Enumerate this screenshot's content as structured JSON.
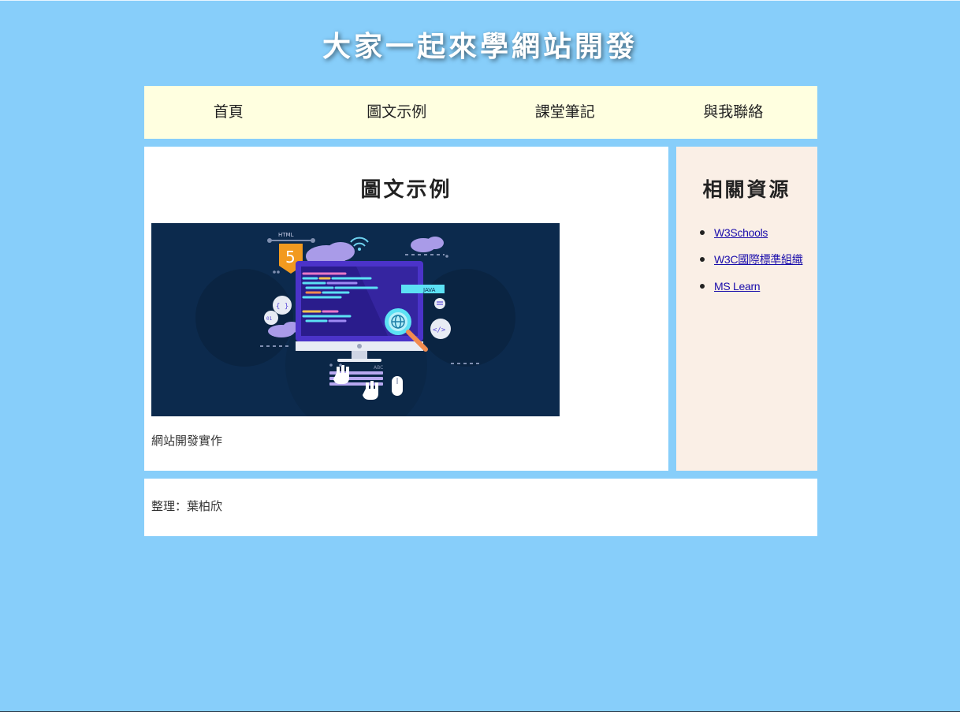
{
  "site": {
    "title": "大家一起來學網站開發"
  },
  "nav": {
    "items": [
      {
        "label": "首頁"
      },
      {
        "label": "圖文示例"
      },
      {
        "label": "課堂筆記"
      },
      {
        "label": "與我聯絡"
      }
    ]
  },
  "main": {
    "heading": "圖文示例",
    "image": {
      "icon": "web-development-illustration",
      "badge_label": "HTML",
      "badge_number": "5",
      "tag_label": "JAVA",
      "keyboard_label": "ABC",
      "background_color": "#0c2a4d"
    },
    "caption": "網站開發實作"
  },
  "aside": {
    "heading": "相關資源",
    "links": [
      {
        "label": "W3Schools"
      },
      {
        "label": "W3C國際標準組織"
      },
      {
        "label": "MS Learn"
      }
    ]
  },
  "footer": {
    "text": "整理：葉柏欣"
  },
  "colors": {
    "page_background": "#87cefa",
    "nav_background": "#ffffe0",
    "aside_background": "#faefe6",
    "content_background": "#ffffff",
    "link_color": "#1a0dab"
  }
}
